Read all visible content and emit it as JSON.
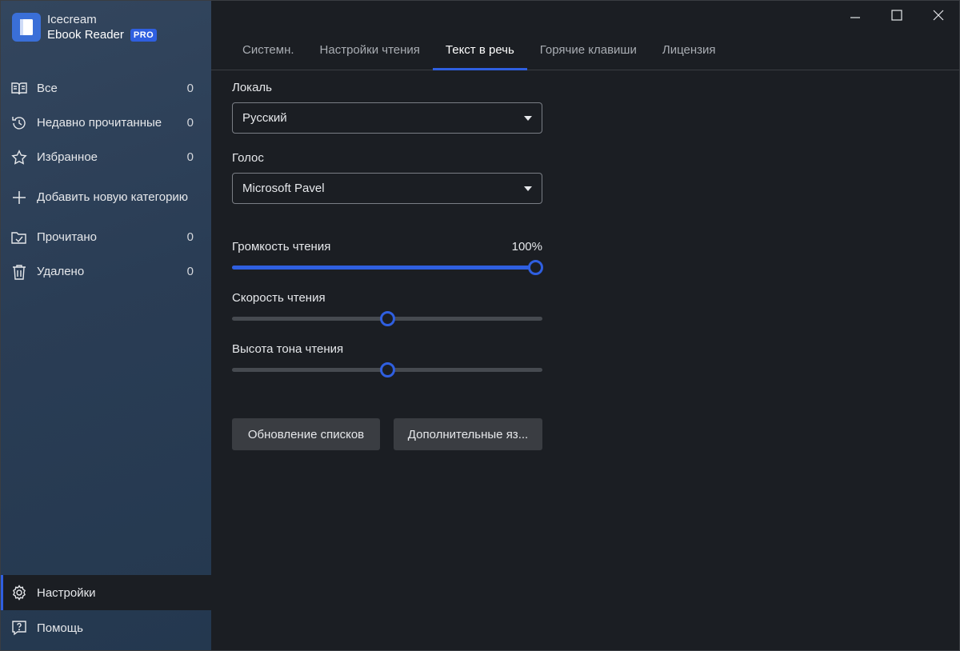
{
  "brand": {
    "line1": "Icecream",
    "line2": "Ebook Reader",
    "badge": "PRO"
  },
  "colors": {
    "accent": "#2f5fe0",
    "sidebar": "#2c3f57",
    "background": "#1b1e23"
  },
  "sidebar": {
    "items": [
      {
        "label": "Все",
        "count": "0",
        "icon": "book-open-icon"
      },
      {
        "label": "Недавно прочитанные",
        "count": "0",
        "icon": "history-icon"
      },
      {
        "label": "Избранное",
        "count": "0",
        "icon": "star-icon"
      },
      {
        "label": "Добавить новую категорию",
        "count": "",
        "icon": "plus-icon"
      },
      {
        "label": "Прочитано",
        "count": "0",
        "icon": "folder-check-icon"
      },
      {
        "label": "Удалено",
        "count": "0",
        "icon": "trash-icon"
      }
    ],
    "bottom": [
      {
        "label": "Настройки",
        "icon": "gear-icon",
        "active": true
      },
      {
        "label": "Помощь",
        "icon": "help-icon"
      }
    ]
  },
  "tabs": [
    {
      "label": "Системн."
    },
    {
      "label": "Настройки чтения"
    },
    {
      "label": "Текст в речь",
      "active": true
    },
    {
      "label": "Горячие клавиши"
    },
    {
      "label": "Лицензия"
    }
  ],
  "settings": {
    "locale": {
      "label": "Локаль",
      "value": "Русский"
    },
    "voice": {
      "label": "Голос",
      "value": "Microsoft Pavel"
    },
    "volume": {
      "label": "Громкость чтения",
      "value_text": "100%",
      "percent": 100
    },
    "speed": {
      "label": "Скорость чтения",
      "percent": 50
    },
    "pitch": {
      "label": "Высота тона чтения",
      "percent": 50
    }
  },
  "buttons": {
    "update_lists": "Обновление списков",
    "extra_languages": "Дополнительные яз..."
  }
}
